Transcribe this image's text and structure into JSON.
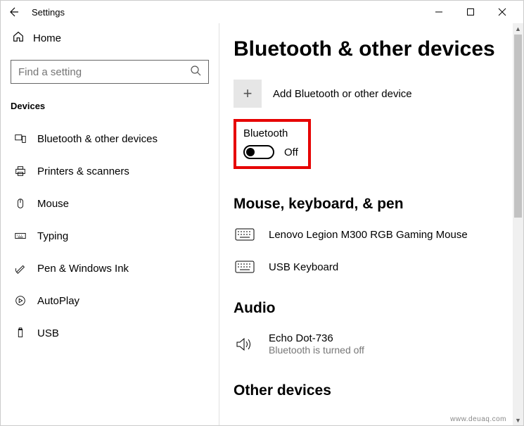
{
  "window": {
    "title": "Settings"
  },
  "sidebar": {
    "home": "Home",
    "search_placeholder": "Find a setting",
    "section": "Devices",
    "items": [
      {
        "label": "Bluetooth & other devices"
      },
      {
        "label": "Printers & scanners"
      },
      {
        "label": "Mouse"
      },
      {
        "label": "Typing"
      },
      {
        "label": "Pen & Windows Ink"
      },
      {
        "label": "AutoPlay"
      },
      {
        "label": "USB"
      }
    ]
  },
  "content": {
    "heading": "Bluetooth & other devices",
    "add_device": "Add Bluetooth or other device",
    "bluetooth_label": "Bluetooth",
    "bluetooth_state": "Off",
    "sections": {
      "mouse_keyboard": {
        "title": "Mouse, keyboard, & pen",
        "devices": [
          {
            "name": "Lenovo Legion M300 RGB Gaming Mouse"
          },
          {
            "name": "USB Keyboard"
          }
        ]
      },
      "audio": {
        "title": "Audio",
        "devices": [
          {
            "name": "Echo Dot-736",
            "status": "Bluetooth is turned off"
          }
        ]
      },
      "other": {
        "title": "Other devices"
      }
    }
  },
  "watermark": "www.deuaq.com"
}
